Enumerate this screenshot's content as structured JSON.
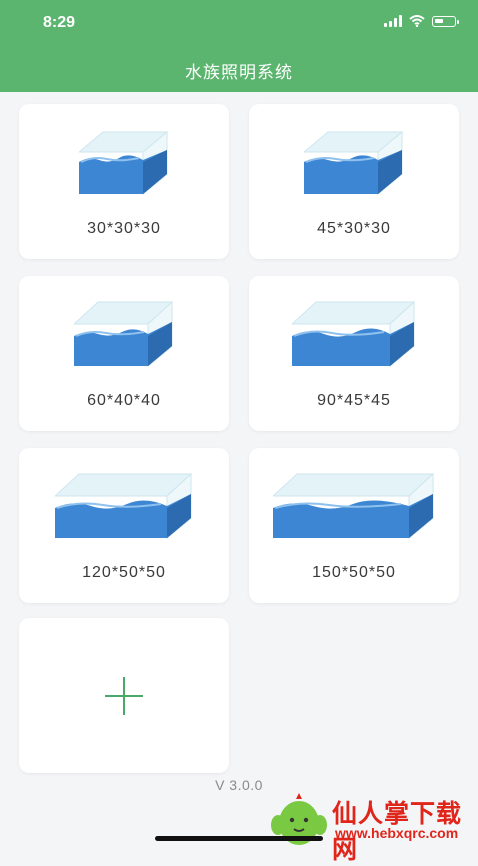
{
  "status_bar": {
    "time": "8:29",
    "icons": [
      "signal-icon",
      "wifi-icon",
      "battery-icon"
    ]
  },
  "header": {
    "title": "水族照明系统",
    "background": "#5bb56f"
  },
  "tanks": [
    {
      "label": "30*30*30"
    },
    {
      "label": "45*30*30"
    },
    {
      "label": "60*40*40"
    },
    {
      "label": "90*45*45"
    },
    {
      "label": "120*50*50"
    },
    {
      "label": "150*50*50"
    }
  ],
  "add_button": {
    "icon": "plus-icon",
    "color": "#4aa868"
  },
  "version": "V 3.0.0",
  "watermark": {
    "text": "仙人掌下载网",
    "url": "www.hebxqrc.com",
    "color": "#e0261b"
  },
  "colors": {
    "water": "#3d86d3",
    "water_dark": "#2c6bb0",
    "glass": "#e3f3f8"
  }
}
